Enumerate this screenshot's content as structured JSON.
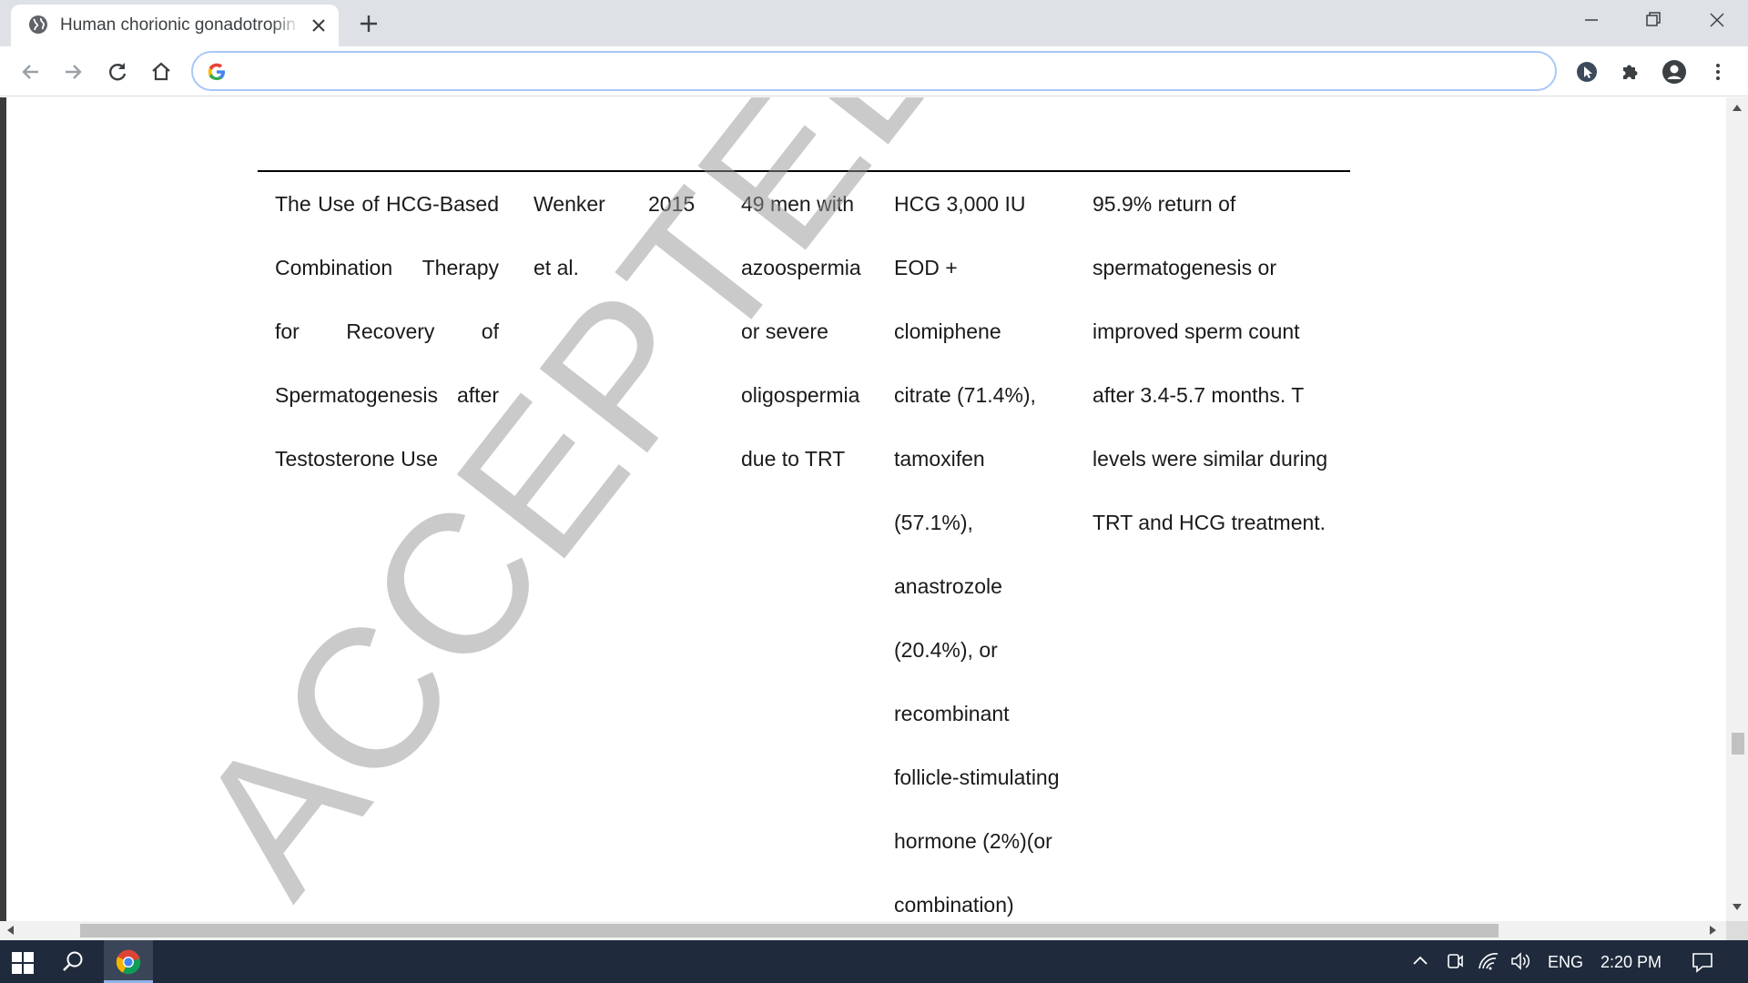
{
  "browser": {
    "tab_title": "Human chorionic gonadotropin t",
    "address_value": "",
    "address_placeholder": ""
  },
  "document": {
    "table_row": {
      "title_lines": [
        "The Use of HCG-Based",
        "Combination Therapy",
        "for Recovery of",
        "Spermatogenesis after",
        "Testosterone Use"
      ],
      "author_lines": [
        "Wenker",
        "et al."
      ],
      "year": "2015",
      "population_lines": [
        "49 men with",
        "azoospermia",
        "or severe",
        "oligospermia",
        "due to TRT"
      ],
      "intervention_lines": [
        "HCG 3,000 IU",
        "EOD +",
        "clomiphene",
        "citrate (71.4%),",
        "tamoxifen",
        "(57.1%),",
        "anastrozole",
        "(20.4%), or",
        "recombinant",
        "follicle-stimulating",
        "hormone (2%)(or",
        "combination)"
      ],
      "outcome_lines": [
        "95.9% return of",
        "spermatogenesis or",
        "improved sperm count",
        "after 3.4-5.7 months. T",
        "levels were similar during",
        "TRT and HCG treatment."
      ]
    },
    "watermark": "ACCEPTED MA"
  },
  "taskbar": {
    "language": "ENG",
    "time": "2:20 PM"
  },
  "colors": {
    "tabstrip": "#dee1e6",
    "omnibox_focus": "#a8c7fa",
    "taskbar": "#1f2b3d",
    "text": "#1a1a1a",
    "watermark": "#969696"
  }
}
